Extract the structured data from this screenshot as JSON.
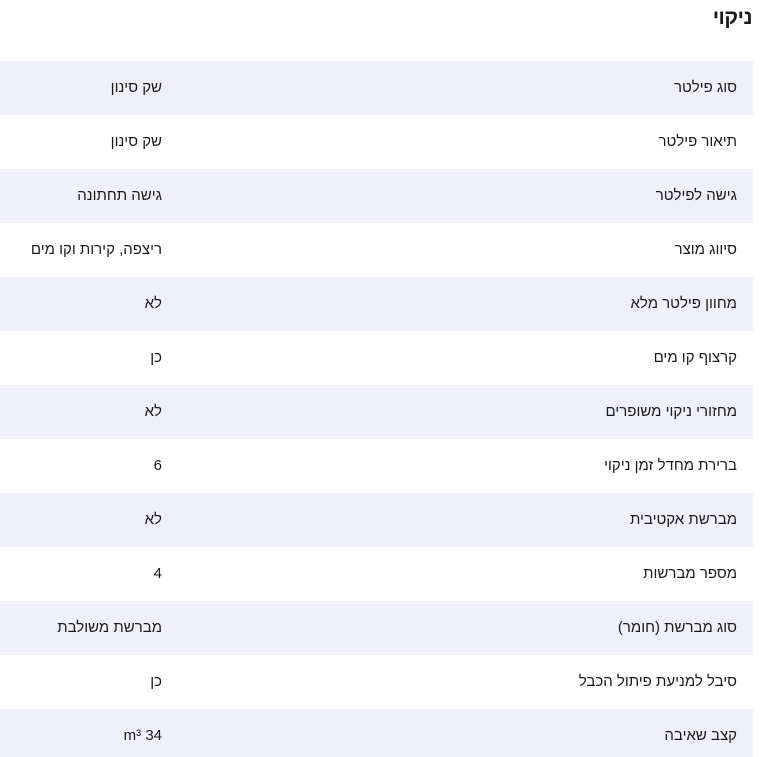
{
  "section": {
    "title": "ניקוי"
  },
  "rows": [
    {
      "label": "סוג פילטר",
      "value": "שק סינון"
    },
    {
      "label": "תיאור פילטר",
      "value": "שק סינון"
    },
    {
      "label": "גישה לפילטר",
      "value": "גישה תחתונה"
    },
    {
      "label": "סיווג מוצר",
      "value": "ריצפה, קירות וקו מים"
    },
    {
      "label": "מחוון פילטר מלא",
      "value": "לא"
    },
    {
      "label": "קרצוף קו מים",
      "value": "כן"
    },
    {
      "label": "מחזורי ניקוי משופרים",
      "value": "לא"
    },
    {
      "label": "ברירת מחדל זמן ניקוי",
      "value": "6"
    },
    {
      "label": "מברשת אקטיבית",
      "value": "לא"
    },
    {
      "label": "מספר מברשות",
      "value": "4"
    },
    {
      "label": "סוג מברשת (חומר)",
      "value": "מברשת משולבת"
    },
    {
      "label": "סיבל למניעת פיתול הכבל",
      "value": "כן"
    },
    {
      "label": "קצב שאיבה",
      "value": "34 m³"
    }
  ]
}
